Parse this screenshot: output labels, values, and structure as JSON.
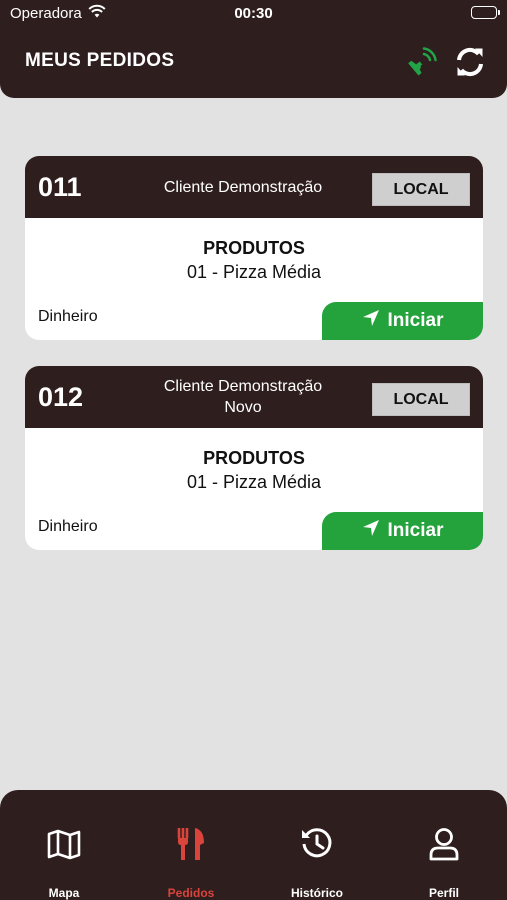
{
  "status_bar": {
    "carrier": "Operadora",
    "time": "00:30"
  },
  "header": {
    "title": "MEUS PEDIDOS",
    "gps_icon": "gps-signal-icon",
    "refresh_icon": "refresh-icon"
  },
  "colors": {
    "dark": "#2f1e1e",
    "accent_green": "#24a23b",
    "active_red": "#d9443c",
    "background": "#e2e2e2"
  },
  "orders": [
    {
      "number": "011",
      "client": "Cliente Demonstração",
      "client_sub": "",
      "badge": "LOCAL",
      "products_title": "PRODUTOS",
      "product": "01 - Pizza  Média",
      "payment": "Dinheiro",
      "action": "Iniciar"
    },
    {
      "number": "012",
      "client": "Cliente Demonstração",
      "client_sub": "Novo",
      "badge": "LOCAL",
      "products_title": "PRODUTOS",
      "product": "01 - Pizza  Média",
      "payment": "Dinheiro",
      "action": "Iniciar"
    }
  ],
  "nav": [
    {
      "label": "Mapa",
      "icon": "map-icon",
      "active": false
    },
    {
      "label": "Pedidos",
      "icon": "fork-knife-icon",
      "active": true
    },
    {
      "label": "Histórico",
      "icon": "history-icon",
      "active": false
    },
    {
      "label": "Perfil",
      "icon": "user-icon",
      "active": false
    }
  ]
}
